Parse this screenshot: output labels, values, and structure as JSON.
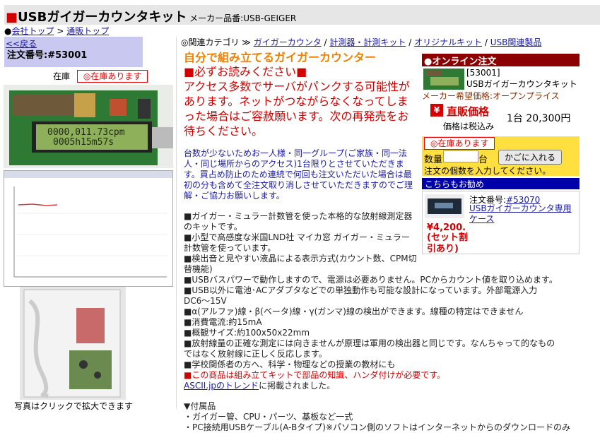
{
  "header": {
    "square": "■",
    "title": "USBガイガーカウンタキット",
    "maker": "メーカー品番:USB-GEIGER"
  },
  "breadcrumb": {
    "bullet": "●",
    "company_top": "会社トップ",
    "sep": " > ",
    "shop_top": "通販トップ"
  },
  "left": {
    "back": "<<戻る",
    "order_no": "注文番号:#53001",
    "stock_label": "在庫",
    "stock_badge": "◎在庫あります",
    "lcd_line1": "0000,011.73cpm",
    "lcd_line2": "0005h15m57s",
    "caption": "写真はクリックで拡大できます"
  },
  "categories": {
    "label": "◎関連カテゴリ ≫",
    "items": [
      "ガイガーカウンタ",
      "計測器・計測キット",
      "オリジナルキット",
      "USB関連製品"
    ],
    "sep": " / "
  },
  "middle": {
    "headline": "自分で組み立てるガイガーカウンター",
    "must_read": "■必ずお読みください■",
    "notice": "アクセス多数でサーバがパンクする可能性があります。ネットがつながらなくなってしまった場合はご容赦願います。次の再発売をお待ちください。",
    "limit": "台数が少ないためお一人様・同一グループ(ご家族・同一法人・同じ場所からのアクセス)1台限りとさせていただきます。買占め防止のため連続で何回も注文いただいた場合は最初の分も含めて全注文取り消しさせていただきますのでご理解・ご協力お願いします。",
    "features": [
      "■ガイガー・ミュラー計数管を使った本格的な放射線測定器のキットです。",
      "■小型で高感度な米国LND社 マイカ窓 ガイガー・ミュラー計数管を使っています。",
      "■検出音と見やすい液晶による表示方式(カウント数、CPM切替機能)",
      "■USBバスパワーで動作しますので、電源は必要ありません。PCからカウント値を取り込めます。",
      "■USB以外に電池･ACアダプタなどでの単独動作も可能な設計になっています。外部電源入力DC6〜15V",
      "■α(アルファ)線・β(ベータ)線・γ(ガンマ)線の検出ができます。線種の特定はできません",
      "■消費電流:約15mA",
      "■概観サイズ:約100x50x22mm",
      "■放射線量の正確な測定には向きませんが原理は軍用の検出器と同じです。なんちゃって的なものではなく放射線に正しく反応します。",
      "■学校関係者の方へ、科学・物理などの授業の教材にも"
    ],
    "warning": "■この商品は組み立てキットで部品の知識、ハンダ付けが必要です。",
    "ascii_link": "ASCII.jpのトレンド",
    "ascii_rest": "に掲載されました。",
    "accessories_title": "▼付属品",
    "acc1": "・ガイガー管、CPU・パーツ、基板など一式",
    "acc2": "・PC接続用USBケーブル(A-Bタイプ)※パソコン側のソフトはインターネットからのダウンロードのみ"
  },
  "order": {
    "header": "●オンライン注文",
    "code": "[53001]",
    "name": "USBガイガーカウンタキット",
    "maker_price": "メーカー希望価格:オープンプライス",
    "yen": "¥",
    "direct": "直販価格",
    "tax": "価格は税込み",
    "price": "1台 20,300円",
    "stock_badge": "◎在庫あります",
    "qty_label": "数量",
    "unit": "台",
    "cart_button": "かごに入れる",
    "qty_hint": "注文の個数を入力してください。",
    "qty_value": ""
  },
  "recommend": {
    "header": "こちらもお勧め",
    "order_prefix": "注文番号:",
    "order_no": "#53070",
    "name": "USBガイガーカウンタ専用ケース",
    "price": "¥4,200.",
    "note": "(セット割引あり)"
  },
  "colors": {
    "red": "#d40000",
    "orange": "#f08000",
    "link": "#1a1aa6",
    "order_header": "#8b0000",
    "yellow": "#ffe040",
    "navy": "#0000aa"
  }
}
